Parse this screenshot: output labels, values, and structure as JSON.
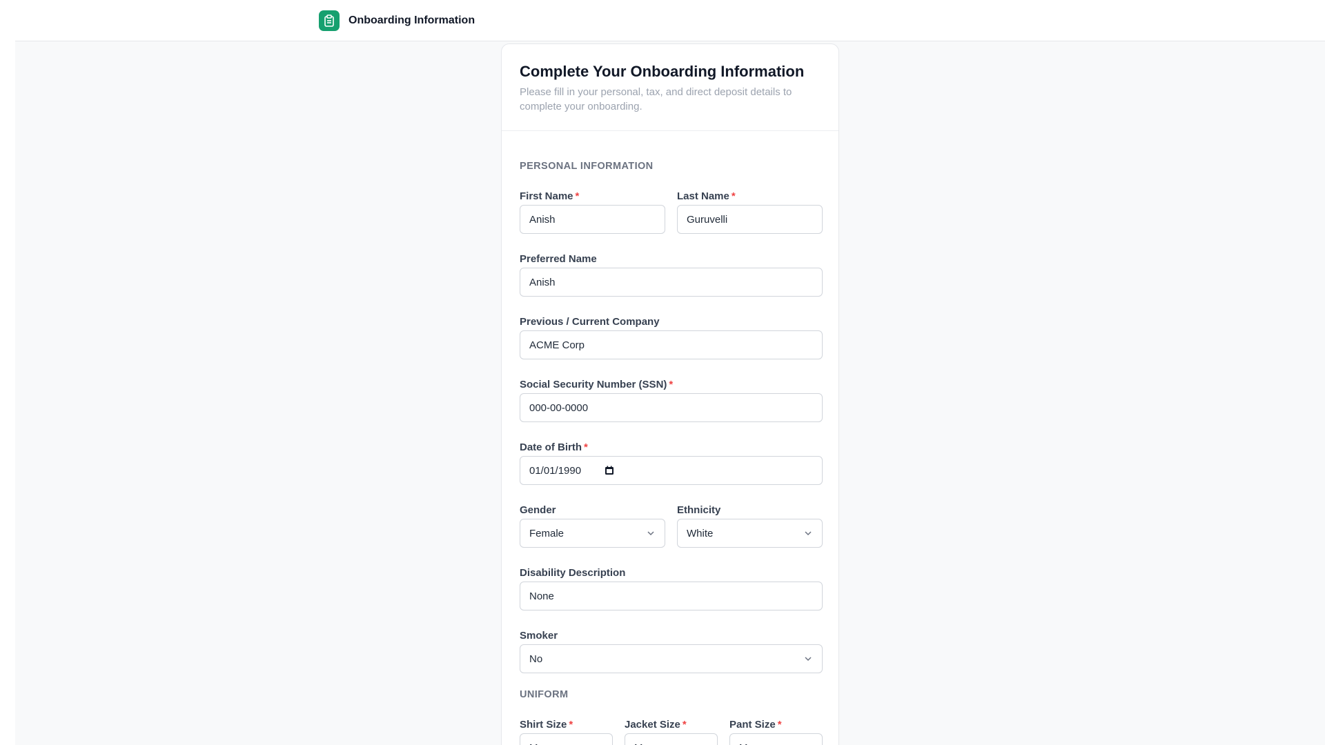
{
  "header": {
    "title": "Onboarding Information",
    "icon": "clipboard-icon",
    "accent": "#16a06f"
  },
  "card": {
    "title": "Complete Your Onboarding Information",
    "subtitle": "Please fill in your personal, tax, and direct deposit details to complete your onboarding."
  },
  "personal": {
    "section": "PERSONAL INFORMATION",
    "first_name": {
      "label": "First Name",
      "value": "Anish"
    },
    "last_name": {
      "label": "Last Name",
      "value": "Guruvelli"
    },
    "preferred_name": {
      "label": "Preferred Name",
      "value": "Anish"
    },
    "company": {
      "label": "Previous / Current Company",
      "value": "ACME Corp"
    },
    "ssn": {
      "label": "Social Security Number (SSN)",
      "value": "000-00-0000"
    },
    "dob": {
      "label": "Date of Birth",
      "value": "01/01/1990"
    },
    "gender": {
      "label": "Gender",
      "value": "Female"
    },
    "ethnicity": {
      "label": "Ethnicity",
      "value": "White"
    },
    "disability": {
      "label": "Disability Description",
      "value": "None"
    },
    "smoker": {
      "label": "Smoker",
      "value": "No"
    }
  },
  "uniform": {
    "section": "UNIFORM",
    "shirt": {
      "label": "Shirt Size",
      "value": "M"
    },
    "jacket": {
      "label": "Jacket Size",
      "value": "M"
    },
    "pant": {
      "label": "Pant Size",
      "value": "M"
    }
  },
  "required_marker": "*"
}
